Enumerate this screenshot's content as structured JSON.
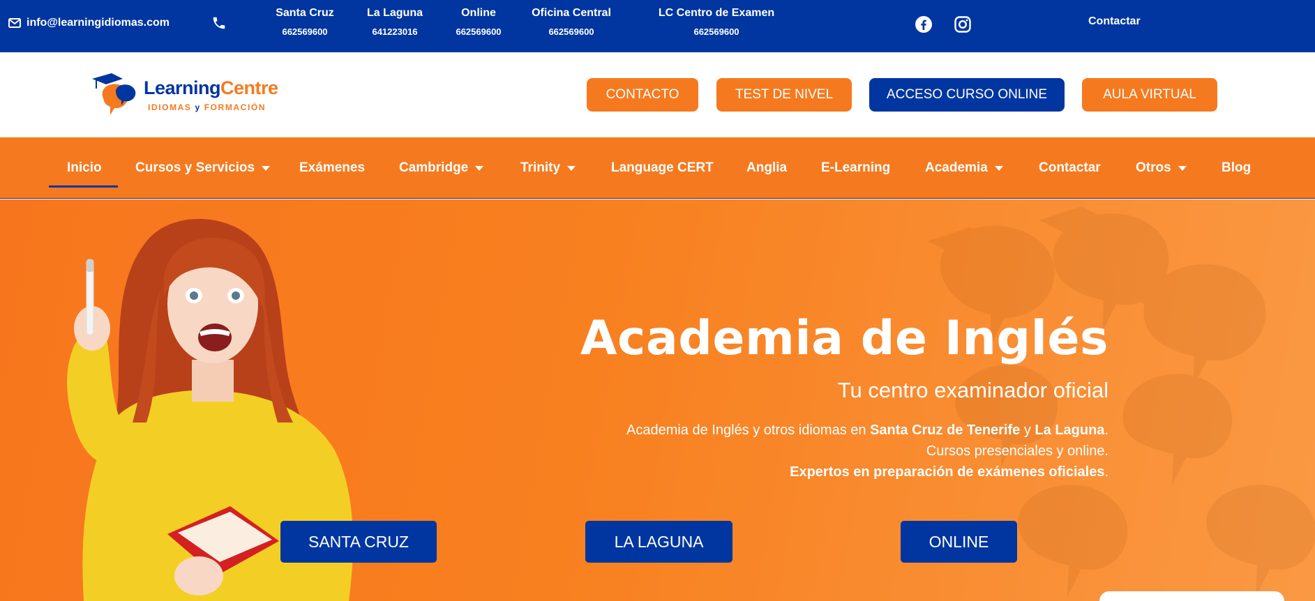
{
  "topbar": {
    "email": "info@learningidiomas.com",
    "locations": [
      {
        "name": "Santa Cruz",
        "phone": "662569600"
      },
      {
        "name": "La Laguna",
        "phone": "641223016"
      },
      {
        "name": "Online",
        "phone": "662569600"
      },
      {
        "name": "Oficina Central",
        "phone": "662569600"
      },
      {
        "name": "LC Centro de Examen",
        "phone": "662569600"
      }
    ],
    "social": [
      "facebook-icon",
      "instagram-icon"
    ],
    "contact_label": "Contactar"
  },
  "logo": {
    "word_part1": "Learning",
    "word_part2": "Centre",
    "tag_part1": "IDIOMAS ",
    "tag_part2": "y ",
    "tag_part3": "FORMACIÓN"
  },
  "header": {
    "buttons": [
      {
        "label": "CONTACTO",
        "color": "#f57a1f"
      },
      {
        "label": "TEST DE NIVEL",
        "color": "#f57a1f"
      },
      {
        "label": "ACCESO CURSO ONLINE",
        "color": "#0136a0"
      },
      {
        "label": "AULA VIRTUAL",
        "color": "#f57a1f"
      }
    ]
  },
  "nav": {
    "items": [
      {
        "label": "Inicio",
        "dropdown": false,
        "active": true
      },
      {
        "label": "Cursos y Servicios",
        "dropdown": true
      },
      {
        "label": "Exámenes",
        "dropdown": false
      },
      {
        "label": "Cambridge",
        "dropdown": true
      },
      {
        "label": "Trinity",
        "dropdown": true
      },
      {
        "label": "Language CERT",
        "dropdown": false
      },
      {
        "label": "Anglia",
        "dropdown": false
      },
      {
        "label": "E-Learning",
        "dropdown": false
      },
      {
        "label": "Academia",
        "dropdown": true
      },
      {
        "label": "Contactar",
        "dropdown": false
      },
      {
        "label": "Otros",
        "dropdown": true
      },
      {
        "label": "Blog",
        "dropdown": false
      }
    ]
  },
  "hero": {
    "title": "Academia de Inglés",
    "subtitle": "Tu centro examinador oficial",
    "desc_line1_a": "Academia de Inglés y otros idiomas en ",
    "desc_line1_b": "Santa Cruz de Tenerife",
    "desc_line1_c": " y ",
    "desc_line1_d": "La Laguna",
    "desc_line1_e": ".",
    "desc_line2": "Cursos presenciales y online.",
    "desc_line3_a": "Expertos en preparación de exámenes oficiales",
    "desc_line3_b": ".",
    "buttons": [
      "SANTA CRUZ",
      "LA LAGUNA",
      "ONLINE"
    ]
  },
  "colors": {
    "brand_blue": "#0136a0",
    "brand_orange": "#f57a1f"
  }
}
